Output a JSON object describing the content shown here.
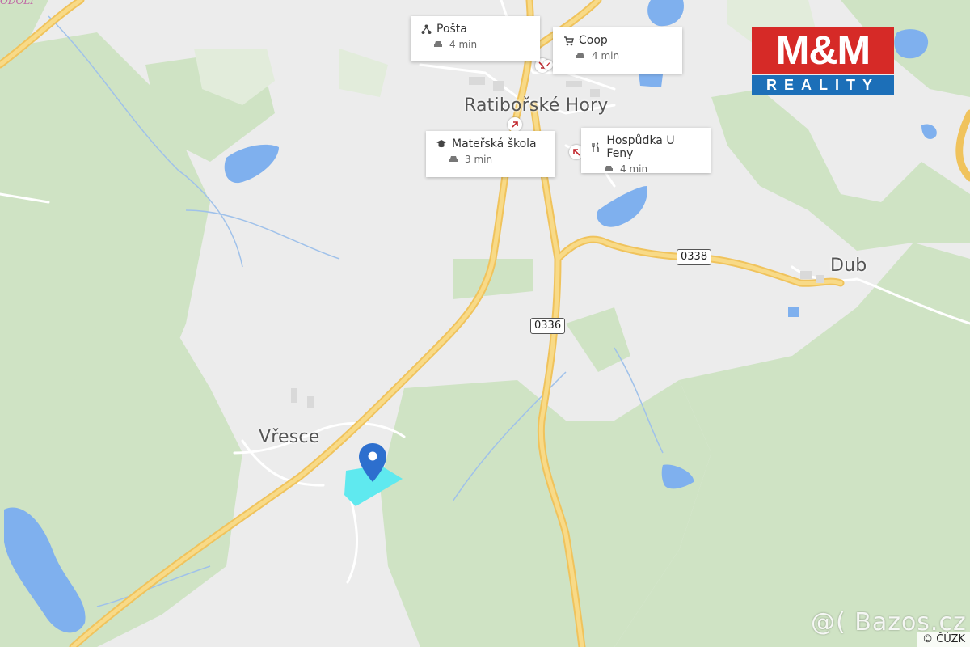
{
  "map": {
    "corner_fragment": "ODOLÍ",
    "towns": [
      {
        "id": "ratiborske-hory",
        "label": "Ratibořské Hory"
      },
      {
        "id": "vresce",
        "label": "Vřesce"
      },
      {
        "id": "dub",
        "label": "Dub"
      }
    ],
    "road_numbers": {
      "r0338": "0338",
      "r0336": "0336"
    },
    "pois": [
      {
        "id": "posta",
        "name": "Pošta",
        "icon": "post-office-icon",
        "time": "4 min"
      },
      {
        "id": "coop",
        "name": "Coop",
        "icon": "shopping-cart-icon",
        "time": "4 min"
      },
      {
        "id": "skola",
        "name": "Mateřská škola",
        "icon": "graduation-cap-icon",
        "time": "3 min"
      },
      {
        "id": "hospudka",
        "name": "Hospůdka U Feny",
        "icon": "fork-knife-icon",
        "time": "4 min"
      }
    ],
    "colors": {
      "road": "#f6cf6b",
      "water": "#7fb0ee",
      "forest": "#c9dfbe",
      "parcel": "#5fe9ef",
      "pin": "#2d6fce"
    }
  },
  "logo": {
    "top_text": "M&M",
    "bottom_text": "REALITY"
  },
  "attribution": "© ČÚZK",
  "watermark": "@( Bazos.cz"
}
